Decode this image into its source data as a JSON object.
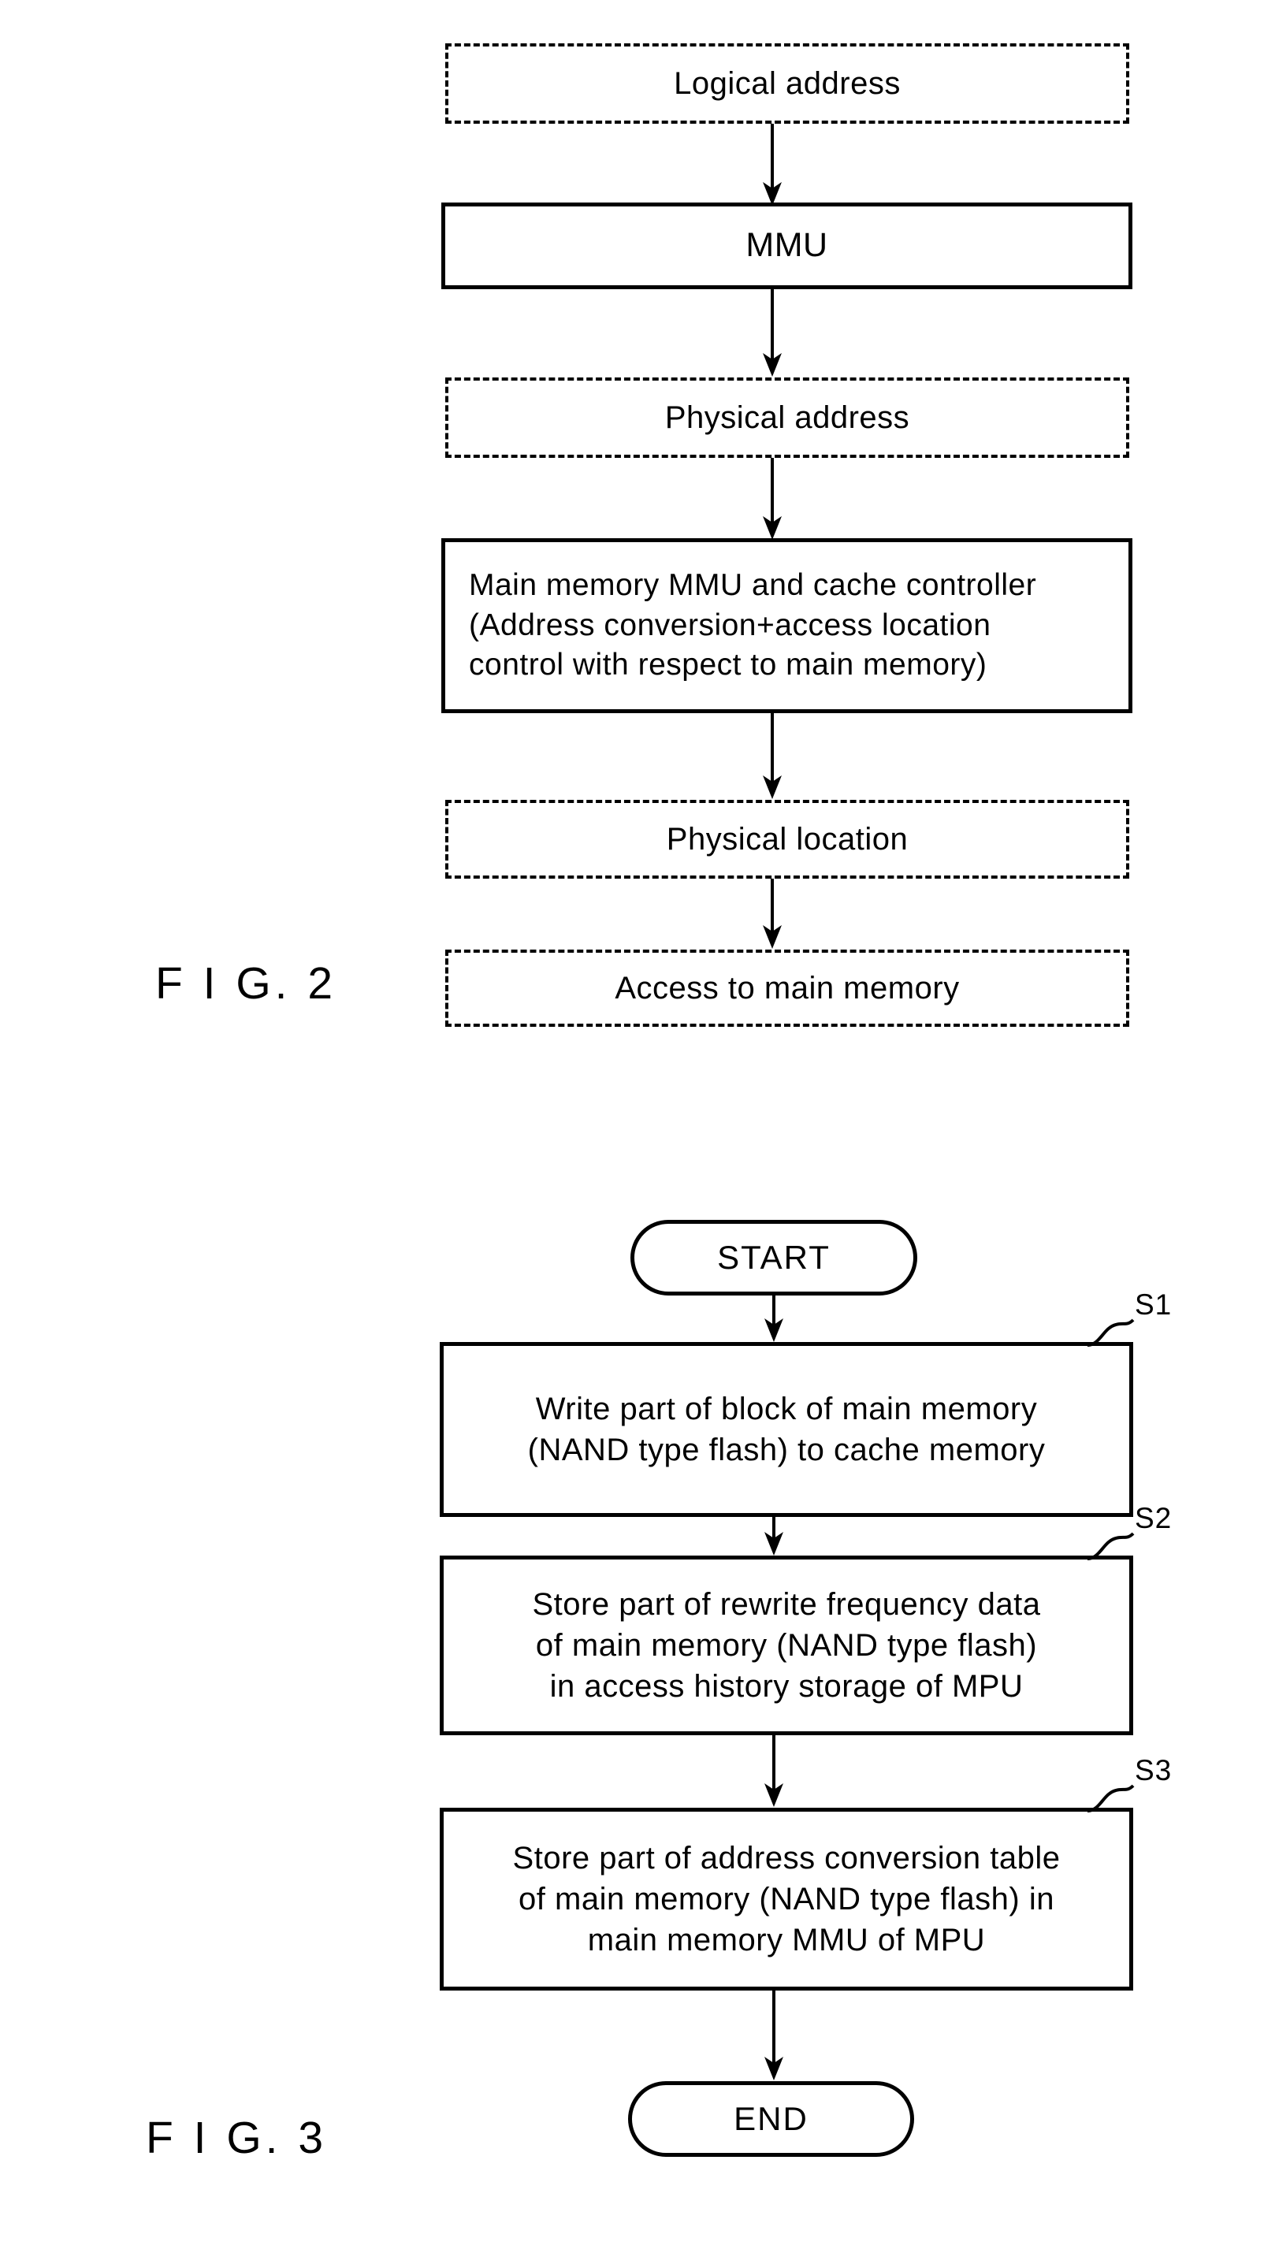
{
  "figures": [
    {
      "id": "fig2",
      "caption": "F I G. 2",
      "nodes": [
        {
          "id": "logical_address",
          "label": "Logical address",
          "style": "dashed"
        },
        {
          "id": "mmu",
          "label": "MMU",
          "style": "solid"
        },
        {
          "id": "physical_address",
          "label": "Physical address",
          "style": "dashed"
        },
        {
          "id": "main_memory_mmu",
          "label": "Main memory MMU and cache controller\n(Address conversion+access location\ncontrol with respect to main memory)",
          "style": "solid"
        },
        {
          "id": "physical_location",
          "label": "Physical location",
          "style": "dashed"
        },
        {
          "id": "access_main_memory",
          "label": "Access to main memory",
          "style": "dashed"
        }
      ]
    },
    {
      "id": "fig3",
      "caption": "F I G. 3",
      "nodes": [
        {
          "id": "start",
          "label": "START",
          "style": "terminal"
        },
        {
          "id": "s1",
          "label": "Write part of block of main memory\n(NAND type flash) to cache memory",
          "style": "solid",
          "tag": "S1"
        },
        {
          "id": "s2",
          "label": "Store part of rewrite frequency data\nof main memory (NAND type flash)\nin access history storage of MPU",
          "style": "solid",
          "tag": "S2"
        },
        {
          "id": "s3",
          "label": "Store part of address conversion table\nof main memory (NAND type flash) in\nmain memory MMU of MPU",
          "style": "solid",
          "tag": "S3"
        },
        {
          "id": "end",
          "label": "END",
          "style": "terminal"
        }
      ]
    }
  ],
  "colors": {
    "ink": "#000000",
    "paper": "#ffffff"
  }
}
